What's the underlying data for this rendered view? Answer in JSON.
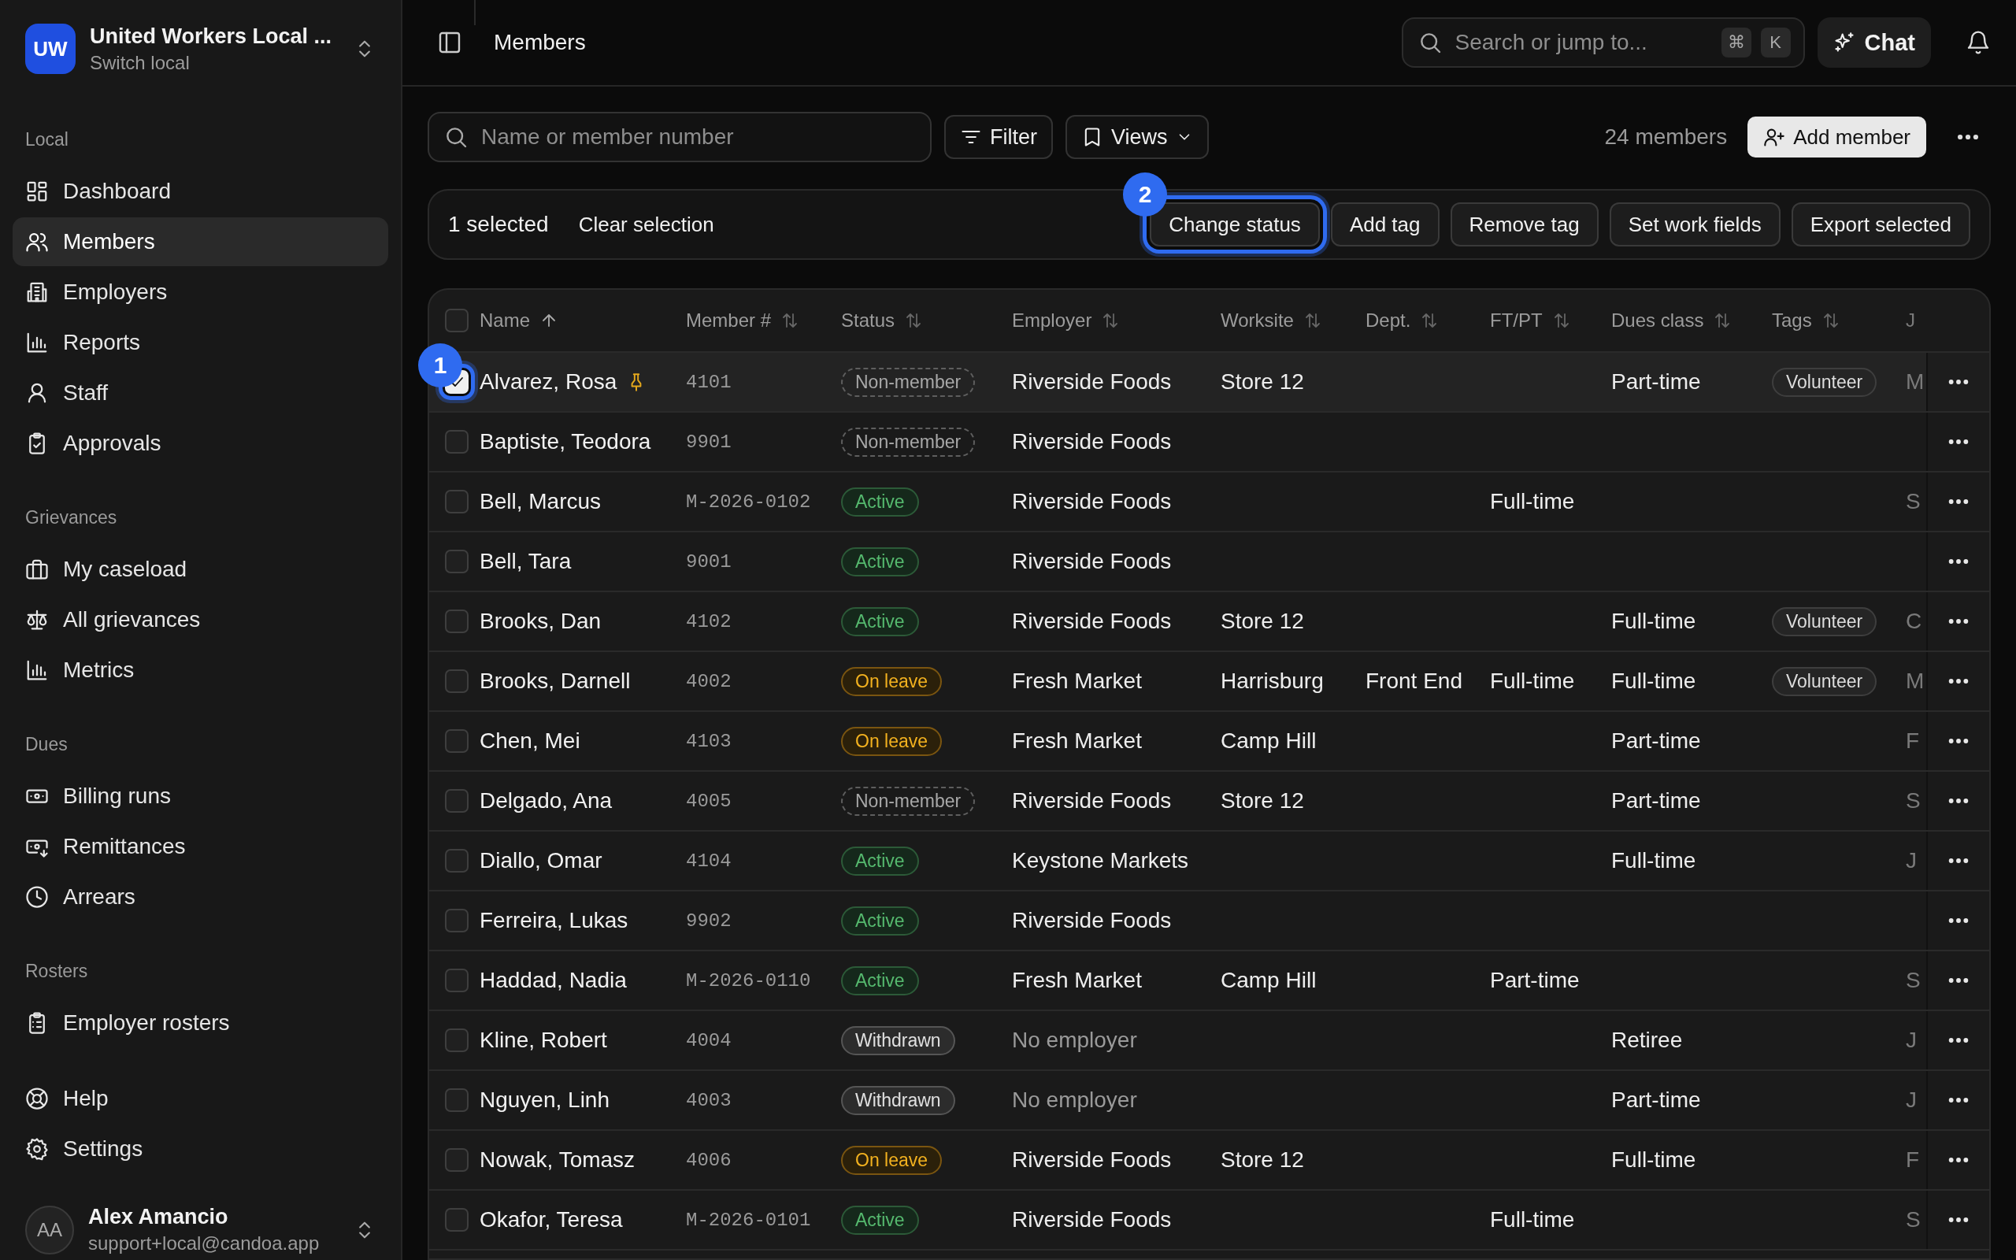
{
  "sidebar": {
    "org": {
      "initials": "UW",
      "name": "United Workers Local ...",
      "subtitle": "Switch local"
    },
    "sections": [
      {
        "heading": "Local",
        "items": [
          {
            "label": "Dashboard",
            "selected": false
          },
          {
            "label": "Members",
            "selected": true
          },
          {
            "label": "Employers",
            "selected": false
          },
          {
            "label": "Reports",
            "selected": false
          },
          {
            "label": "Staff",
            "selected": false
          },
          {
            "label": "Approvals",
            "selected": false
          }
        ]
      },
      {
        "heading": "Grievances",
        "items": [
          {
            "label": "My caseload",
            "selected": false
          },
          {
            "label": "All grievances",
            "selected": false
          },
          {
            "label": "Metrics",
            "selected": false
          }
        ]
      },
      {
        "heading": "Dues",
        "items": [
          {
            "label": "Billing runs",
            "selected": false
          },
          {
            "label": "Remittances",
            "selected": false
          },
          {
            "label": "Arrears",
            "selected": false
          }
        ]
      },
      {
        "heading": "Rosters",
        "items": [
          {
            "label": "Employer rosters",
            "selected": false
          }
        ]
      },
      {
        "items": [
          {
            "label": "Help",
            "selected": false
          },
          {
            "label": "Settings",
            "selected": false
          }
        ]
      }
    ],
    "user": {
      "initials": "AA",
      "name": "Alex Amancio",
      "email": "support+local@candoa.app"
    }
  },
  "header": {
    "title": "Members",
    "search": {
      "placeholder": "Search or jump to...",
      "keys": [
        "⌘",
        "K"
      ]
    },
    "chat_button": "Chat"
  },
  "toolbar": {
    "search": {
      "placeholder": "Name or member number"
    },
    "filter_button": "Filter",
    "views_button": "Views",
    "count": "24 members",
    "add_button": "Add member"
  },
  "selection_bar": {
    "count": "1 selected",
    "clear": "Clear selection",
    "actions": [
      {
        "label": "Change status",
        "marker": "2"
      },
      {
        "label": "Add tag"
      },
      {
        "label": "Remove tag"
      },
      {
        "label": "Set work fields"
      },
      {
        "label": "Export selected"
      }
    ]
  },
  "table": {
    "select_all": {
      "checked": false
    },
    "columns": [
      {
        "label": "Name",
        "sortable": true,
        "sorted_ascending": true
      },
      {
        "label": "Member #",
        "sortable": true,
        "sorted_ascending": false
      },
      {
        "label": "Status",
        "sortable": true,
        "sorted_ascending": false
      },
      {
        "label": "Employer",
        "sortable": true,
        "sorted_ascending": false
      },
      {
        "label": "Worksite",
        "sortable": true,
        "sorted_ascending": false
      },
      {
        "label": "Dept.",
        "sortable": true,
        "sorted_ascending": false
      },
      {
        "label": "FT/PT",
        "sortable": true,
        "sorted_ascending": false
      },
      {
        "label": "Dues class",
        "sortable": true,
        "sorted_ascending": false
      },
      {
        "label": "Tags",
        "sortable": true,
        "sorted_ascending": false
      },
      {
        "label": "J",
        "sortable": false,
        "sorted_ascending": false
      }
    ],
    "rows": [
      {
        "selected": true,
        "marker": "1",
        "pinned": true,
        "name": "Alvarez, Rosa",
        "number": "4101",
        "status": {
          "label": "Non-member",
          "kind": "non_member"
        },
        "employer": "Riverside Foods",
        "no_employer": false,
        "worksite": "Store 12",
        "dues_class": "Part-time",
        "tags": [
          "Volunteer"
        ],
        "column_10": "M"
      },
      {
        "selected": false,
        "pinned": false,
        "name": "Baptiste, Teodora",
        "number": "9901",
        "status": {
          "label": "Non-member",
          "kind": "non_member"
        },
        "employer": "Riverside Foods",
        "no_employer": false
      },
      {
        "selected": false,
        "pinned": false,
        "name": "Bell, Marcus",
        "number": "M-2026-0102",
        "status": {
          "label": "Active",
          "kind": "active"
        },
        "employer": "Riverside Foods",
        "no_employer": false,
        "ftpt": "Full-time",
        "column_10": "S"
      },
      {
        "selected": false,
        "pinned": false,
        "name": "Bell, Tara",
        "number": "9001",
        "status": {
          "label": "Active",
          "kind": "active"
        },
        "employer": "Riverside Foods",
        "no_employer": false
      },
      {
        "selected": false,
        "pinned": false,
        "name": "Brooks, Dan",
        "number": "4102",
        "status": {
          "label": "Active",
          "kind": "active"
        },
        "employer": "Riverside Foods",
        "no_employer": false,
        "worksite": "Store 12",
        "dues_class": "Full-time",
        "tags": [
          "Volunteer"
        ],
        "column_10": "C"
      },
      {
        "selected": false,
        "pinned": false,
        "name": "Brooks, Darnell",
        "number": "4002",
        "status": {
          "label": "On leave",
          "kind": "on_leave"
        },
        "employer": "Fresh Market",
        "no_employer": false,
        "worksite": "Harrisburg",
        "dept": "Front End",
        "ftpt": "Full-time",
        "dues_class": "Full-time",
        "tags": [
          "Volunteer"
        ],
        "column_10": "M"
      },
      {
        "selected": false,
        "pinned": false,
        "name": "Chen, Mei",
        "number": "4103",
        "status": {
          "label": "On leave",
          "kind": "on_leave"
        },
        "employer": "Fresh Market",
        "no_employer": false,
        "worksite": "Camp Hill",
        "dues_class": "Part-time",
        "column_10": "F"
      },
      {
        "selected": false,
        "pinned": false,
        "name": "Delgado, Ana",
        "number": "4005",
        "status": {
          "label": "Non-member",
          "kind": "non_member"
        },
        "employer": "Riverside Foods",
        "no_employer": false,
        "worksite": "Store 12",
        "dues_class": "Part-time",
        "column_10": "S"
      },
      {
        "selected": false,
        "pinned": false,
        "name": "Diallo, Omar",
        "number": "4104",
        "status": {
          "label": "Active",
          "kind": "active"
        },
        "employer": "Keystone Markets",
        "no_employer": false,
        "dues_class": "Full-time",
        "column_10": "J"
      },
      {
        "selected": false,
        "pinned": false,
        "name": "Ferreira, Lukas",
        "number": "9902",
        "status": {
          "label": "Active",
          "kind": "active"
        },
        "employer": "Riverside Foods",
        "no_employer": false
      },
      {
        "selected": false,
        "pinned": false,
        "name": "Haddad, Nadia",
        "number": "M-2026-0110",
        "status": {
          "label": "Active",
          "kind": "active"
        },
        "employer": "Fresh Market",
        "no_employer": false,
        "worksite": "Camp Hill",
        "ftpt": "Part-time",
        "column_10": "S"
      },
      {
        "selected": false,
        "pinned": false,
        "name": "Kline, Robert",
        "number": "4004",
        "status": {
          "label": "Withdrawn",
          "kind": "withdrawn"
        },
        "employer": "No employer",
        "no_employer": true,
        "dues_class": "Retiree",
        "column_10": "J"
      },
      {
        "selected": false,
        "pinned": false,
        "name": "Nguyen, Linh",
        "number": "4003",
        "status": {
          "label": "Withdrawn",
          "kind": "withdrawn"
        },
        "employer": "No employer",
        "no_employer": true,
        "dues_class": "Part-time",
        "column_10": "J"
      },
      {
        "selected": false,
        "pinned": false,
        "name": "Nowak, Tomasz",
        "number": "4006",
        "status": {
          "label": "On leave",
          "kind": "on_leave"
        },
        "employer": "Riverside Foods",
        "no_employer": false,
        "worksite": "Store 12",
        "dues_class": "Full-time",
        "column_10": "F"
      },
      {
        "selected": false,
        "pinned": false,
        "name": "Okafor, Teresa",
        "number": "M-2026-0101",
        "status": {
          "label": "Active",
          "kind": "active"
        },
        "employer": "Riverside Foods",
        "no_employer": false,
        "ftpt": "Full-time",
        "column_10": "S"
      }
    ]
  }
}
